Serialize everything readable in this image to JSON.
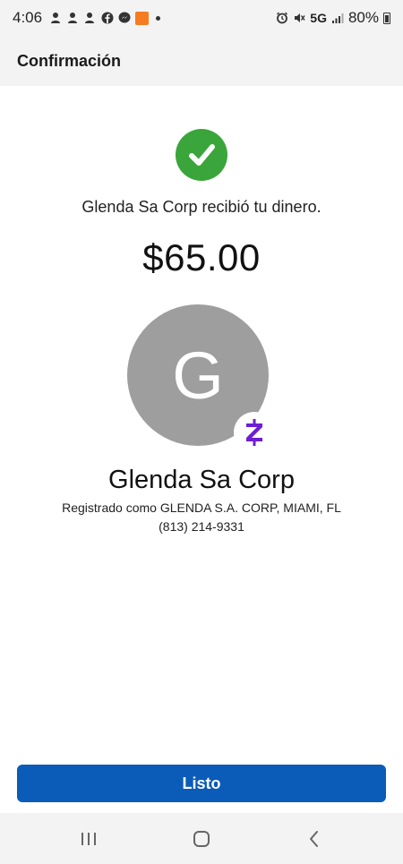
{
  "status_bar": {
    "time": "4:06",
    "network": "5G",
    "battery": "80%"
  },
  "header": {
    "title": "Confirmación"
  },
  "confirmation": {
    "message": "Glenda Sa Corp recibió tu dinero.",
    "amount": "$65.00"
  },
  "recipient": {
    "initial": "G",
    "name": "Glenda Sa Corp",
    "registered_as": "Registrado como GLENDA S.A. CORP, MIAMI, FL",
    "phone": "(813) 214-9331"
  },
  "actions": {
    "done_label": "Listo"
  },
  "colors": {
    "success": "#3aa53a",
    "primary_button": "#0b5bb8",
    "zelle_purple": "#6d1ed4",
    "avatar_bg": "#9e9e9e"
  },
  "icons": {
    "success": "check-icon",
    "payment_service": "zelle-icon",
    "nav_recents": "recents-icon",
    "nav_home": "home-icon",
    "nav_back": "back-icon"
  }
}
